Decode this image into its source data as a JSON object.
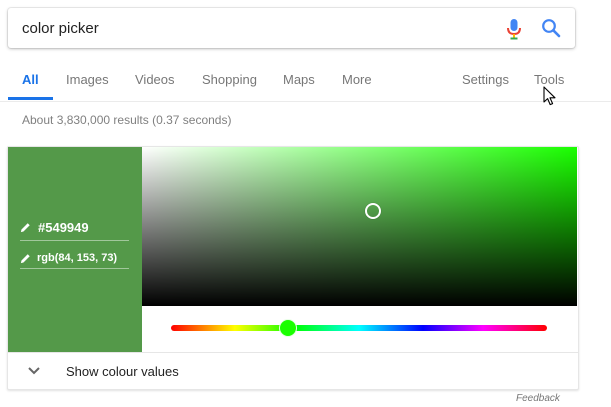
{
  "search": {
    "query": "color picker",
    "icons": {
      "mic": "mic-icon",
      "search": "search-icon"
    },
    "colors": {
      "mic_blue": "#4285f4",
      "mic_red": "#ea4335",
      "mic_yellow": "#fbbc05",
      "mic_green": "#34a853",
      "search_blue": "#4285f4"
    }
  },
  "tabs": {
    "items": [
      {
        "label": "All",
        "active": true
      },
      {
        "label": "Images",
        "active": false
      },
      {
        "label": "Videos",
        "active": false
      },
      {
        "label": "Shopping",
        "active": false
      },
      {
        "label": "Maps",
        "active": false
      },
      {
        "label": "More",
        "active": false
      }
    ],
    "settings_label": "Settings",
    "tools_label": "Tools",
    "accent_color": "#1a73e8"
  },
  "results": {
    "stats": "About 3,830,000 results (0.37 seconds)"
  },
  "color_picker": {
    "hex_value": "#549949",
    "rgb_value": "rgb(84, 153, 73)",
    "swatch_color": "#549949",
    "hue_color": "#1aff00",
    "hue_position_fraction": 0.31,
    "saturation_fraction": 0.53,
    "value_fraction": 0.6,
    "show_values_label": "Show colour values",
    "icons": {
      "edit": "pencil-icon",
      "expand": "chevron-down-icon"
    }
  },
  "footer": {
    "feedback_label": "Feedback"
  }
}
